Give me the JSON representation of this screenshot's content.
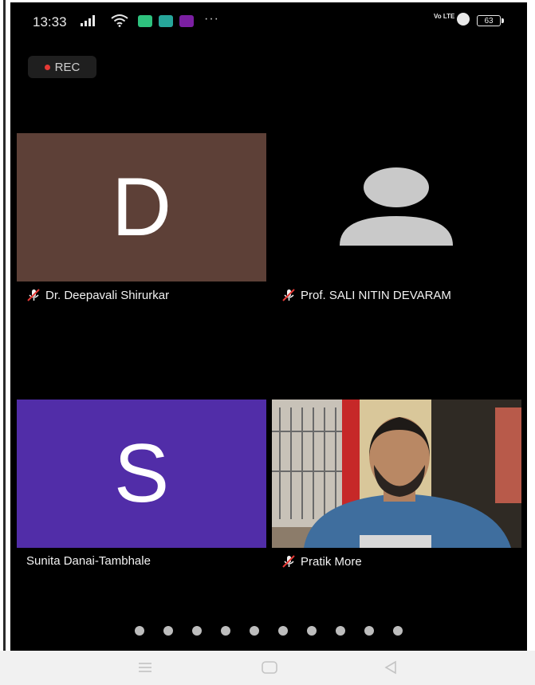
{
  "status_bar": {
    "time": "13:33",
    "network_label": "Vo LTE",
    "battery_level": "63",
    "ellipsis": "···",
    "icons": [
      "signal-icon",
      "wifi-icon",
      "download-app-icon",
      "gallery-app-icon",
      "payment-app-icon",
      "alarm-icon",
      "battery-icon"
    ]
  },
  "recording": {
    "label": "REC",
    "color": "#e53935"
  },
  "participants": [
    {
      "name": "Dr. Deepavali Shirurkar",
      "initial": "D",
      "tile_color": "#5d4037",
      "muted": true
    },
    {
      "name": "Prof. SALI NITIN DEVARAM",
      "initial": "",
      "tile_color": "#000000",
      "muted": true
    },
    {
      "name": "Sunita Danai-Tambhale",
      "initial": "S",
      "tile_color": "#512da8",
      "muted": false
    },
    {
      "name": "Pratik More",
      "initial": "",
      "tile_color": "#4a6f8f",
      "muted": true,
      "has_video": true
    }
  ],
  "page_indicator": {
    "count": 10
  },
  "nav_bar": {
    "icons": [
      "menu-icon",
      "home-icon",
      "back-icon"
    ]
  }
}
